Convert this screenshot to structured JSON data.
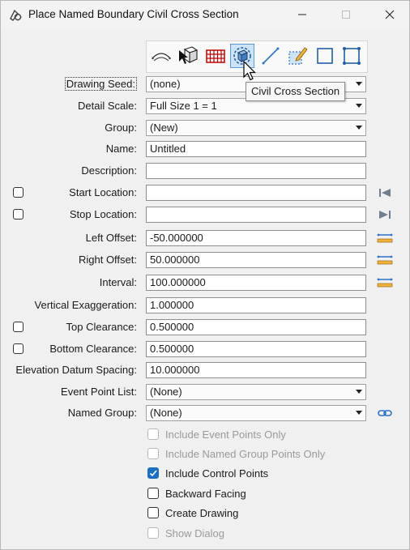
{
  "window": {
    "title": "Place Named Boundary Civil Cross Section"
  },
  "toolbar": {
    "tools": [
      {
        "name": "profile-curve-icon"
      },
      {
        "name": "select-3d-box-icon"
      },
      {
        "name": "grid-icon"
      },
      {
        "name": "civil-cross-section-icon"
      },
      {
        "name": "line-icon"
      },
      {
        "name": "edit-box-icon"
      },
      {
        "name": "square-icon"
      },
      {
        "name": "square-corners-icon"
      }
    ],
    "tooltip": "Civil Cross Section"
  },
  "form": {
    "drawing_seed": {
      "label": "Drawing Seed:",
      "value": "(none)"
    },
    "detail_scale": {
      "label": "Detail Scale:",
      "value": "Full Size 1 = 1"
    },
    "group": {
      "label": "Group:",
      "value": "(New)"
    },
    "name": {
      "label": "Name:",
      "value": "Untitled"
    },
    "description": {
      "label": "Description:",
      "value": ""
    },
    "start_location": {
      "label": "Start Location:",
      "value": ""
    },
    "stop_location": {
      "label": "Stop Location:",
      "value": ""
    },
    "left_offset": {
      "label": "Left Offset:",
      "value": "-50.000000"
    },
    "right_offset": {
      "label": "Right Offset:",
      "value": "50.000000"
    },
    "interval": {
      "label": "Interval:",
      "value": "100.000000"
    },
    "vertical_exaggeration": {
      "label": "Vertical Exaggeration:",
      "value": "1.000000"
    },
    "top_clearance": {
      "label": "Top Clearance:",
      "value": "0.500000"
    },
    "bottom_clearance": {
      "label": "Bottom Clearance:",
      "value": "0.500000"
    },
    "elevation_datum_spacing": {
      "label": "Elevation Datum Spacing:",
      "value": "10.000000"
    },
    "event_point_list": {
      "label": "Event Point List:",
      "value": "(None)"
    },
    "named_group": {
      "label": "Named Group:",
      "value": "(None)"
    }
  },
  "options": [
    {
      "label": "Include Event Points Only",
      "checked": false,
      "enabled": false
    },
    {
      "label": "Include Named Group Points Only",
      "checked": false,
      "enabled": false
    },
    {
      "label": "Include Control Points",
      "checked": true,
      "enabled": true
    },
    {
      "label": "Backward Facing",
      "checked": false,
      "enabled": true
    },
    {
      "label": "Create Drawing",
      "checked": false,
      "enabled": true
    },
    {
      "label": "Show Dialog",
      "checked": false,
      "enabled": false
    }
  ]
}
